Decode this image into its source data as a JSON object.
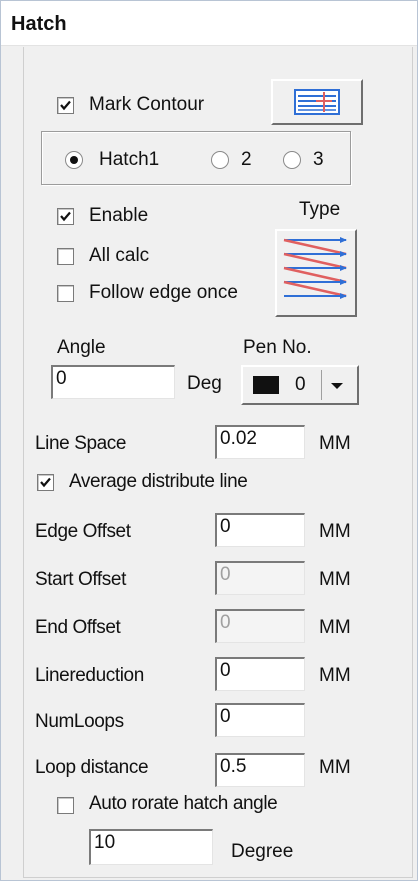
{
  "title": "Hatch",
  "mark_contour": {
    "label": "Mark Contour",
    "checked": true
  },
  "hatch_tabs": [
    {
      "label": "Hatch1",
      "selected": true
    },
    {
      "label": "2",
      "selected": false
    },
    {
      "label": "3",
      "selected": false
    }
  ],
  "enable": {
    "label": "Enable",
    "checked": true
  },
  "all_calc": {
    "label": "All calc",
    "checked": false
  },
  "follow_edge": {
    "label": "Follow edge once",
    "checked": false
  },
  "type_label": "Type",
  "angle": {
    "label": "Angle",
    "value": "0",
    "unit": "Deg"
  },
  "pen": {
    "label": "Pen No.",
    "value": "0",
    "color": "#111111"
  },
  "line_space": {
    "label": "Line Space",
    "value": "0.02",
    "unit": "MM"
  },
  "average_distribute": {
    "label": "Average distribute line",
    "checked": true
  },
  "edge_offset": {
    "label": "Edge Offset",
    "value": "0",
    "unit": "MM"
  },
  "start_offset": {
    "label": "Start Offset",
    "value": "0",
    "unit": "MM",
    "disabled": true
  },
  "end_offset": {
    "label": "End Offset",
    "value": "0",
    "unit": "MM",
    "disabled": true
  },
  "linereduction": {
    "label": "Linereduction",
    "value": "0",
    "unit": "MM"
  },
  "num_loops": {
    "label": "NumLoops",
    "value": "0"
  },
  "loop_distance": {
    "label": "Loop distance",
    "value": "0.5",
    "unit": "MM"
  },
  "auto_rotate": {
    "label": "Auto rorate hatch angle",
    "checked": false
  },
  "rotate_angle": {
    "value": "10",
    "unit": "Degree"
  },
  "icons": {
    "contour_button": "hatch-contour-icon",
    "type_button": "hatch-type-icon",
    "dropdown": "chevron-down-icon"
  },
  "colors": {
    "accent_red": "#e06060",
    "accent_blue": "#2f6fd6"
  }
}
